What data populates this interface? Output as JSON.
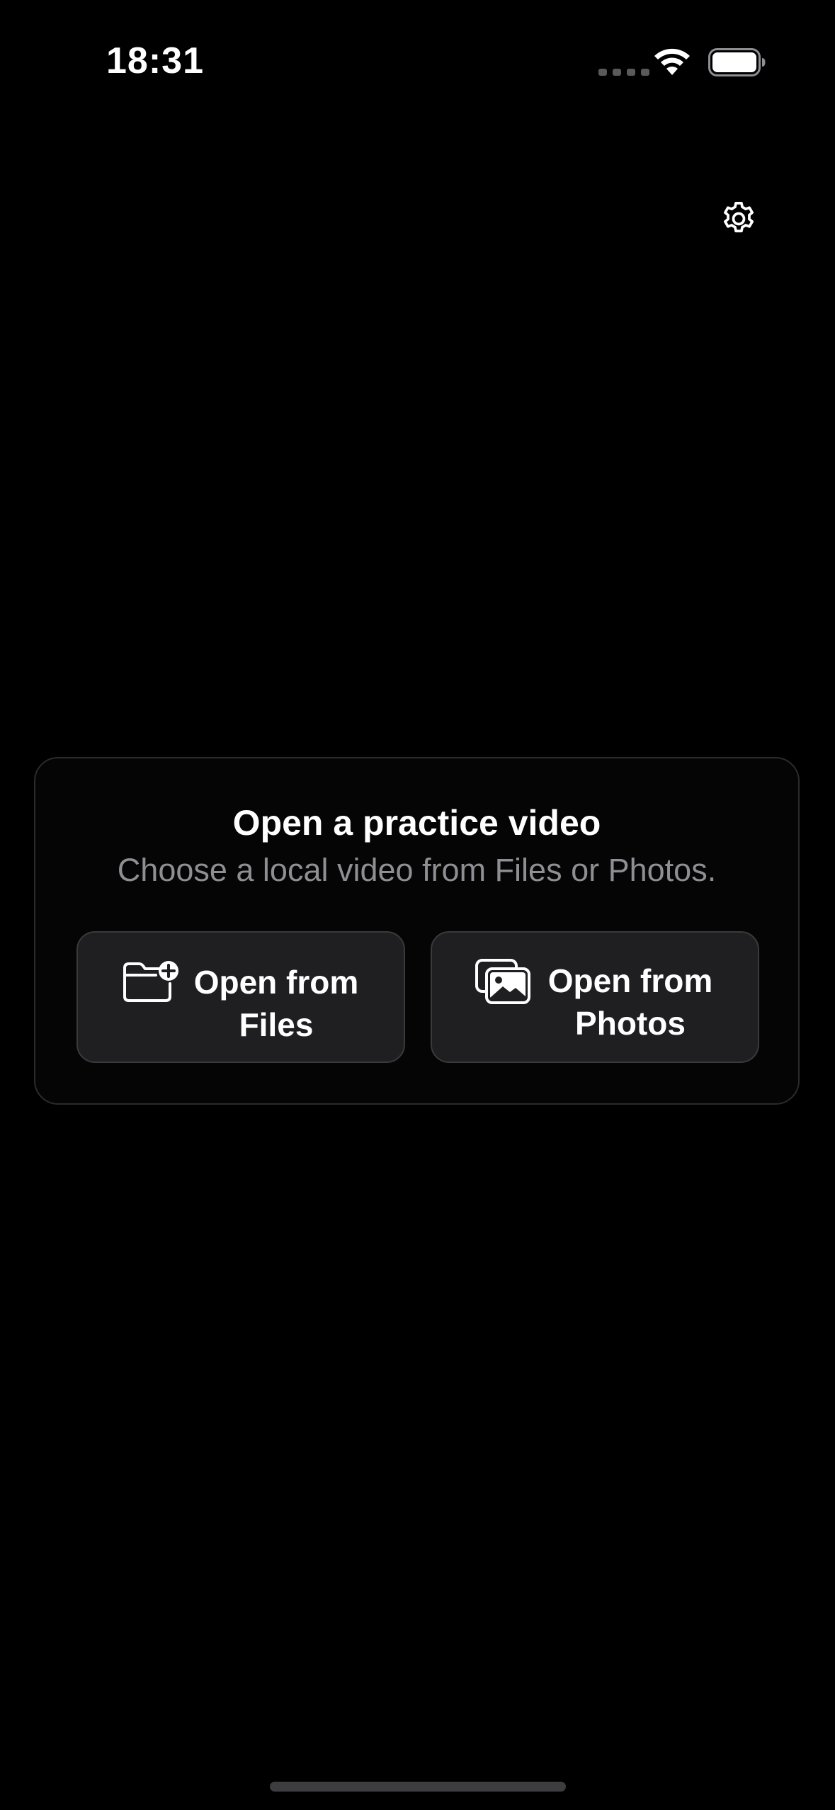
{
  "status_bar": {
    "time": "18:31",
    "signal_icon": "cellular-dots-icon",
    "wifi_icon": "wifi-icon",
    "battery_icon": "battery-icon"
  },
  "toolbar": {
    "settings_icon": "gear-icon"
  },
  "open_card": {
    "title": "Open a practice video",
    "subtitle": "Choose a local video from Files or Photos.",
    "buttons": [
      {
        "label": "Open from Files",
        "icon": "folder-plus-icon"
      },
      {
        "label": "Open from Photos",
        "icon": "photo-stack-icon"
      }
    ]
  },
  "colors": {
    "background": "#000000",
    "card_border": "#2b2b2d",
    "button_fill": "#1f1f21",
    "button_border": "#3a3a3c",
    "secondary_text": "#8e8e93",
    "primary_text": "#ffffff"
  }
}
